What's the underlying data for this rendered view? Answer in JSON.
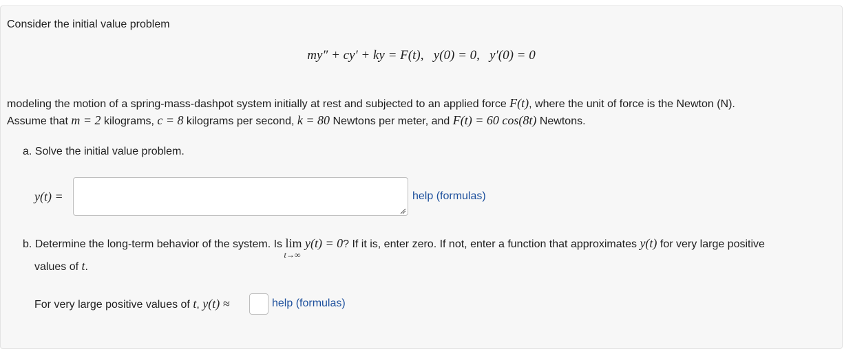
{
  "intro": "Consider the initial value problem",
  "equation": {
    "lhs": "my″ + cy′ + ky = F(t),",
    "ic1": "y(0) = 0,",
    "ic2": "y′(0) = 0"
  },
  "description": {
    "line1_text": "modeling the motion of a spring-mass-dashpot system initially at rest and subjected to an applied force ",
    "line1_math": "F(t)",
    "line1_tail": ", where the unit of force is the Newton (N).",
    "line2_prefix": "Assume that ",
    "m_expr": "m = 2",
    "m_unit": " kilograms, ",
    "c_expr": "c = 8",
    "c_unit": " kilograms per second, ",
    "k_expr": "k = 80",
    "k_unit": " Newtons per meter, and ",
    "f_expr": "F(t) = 60 cos(8t)",
    "f_unit": " Newtons."
  },
  "part_a": {
    "prompt": "a. Solve the initial value problem.",
    "label": "y(t) =",
    "input_value": "",
    "help": "help (formulas)"
  },
  "part_b": {
    "prompt_start": "b. Determine the long-term behavior of the system. Is ",
    "lim_word": "lim",
    "lim_sub": "t→∞",
    "lim_expr": "y(t) = 0",
    "prompt_end": "? If it is, enter zero. If not, enter a function that approximates ",
    "prompt_func": "y(t)",
    "prompt_tail": " for very large positive",
    "line2_start": "values of ",
    "line2_var": "t",
    "line2_end": ".",
    "answer_prefix": "For very large positive values of ",
    "answer_var": "t",
    "answer_sep": ", ",
    "answer_expr": "y(t) ≈",
    "input_value": "",
    "help": "help (formulas)"
  }
}
